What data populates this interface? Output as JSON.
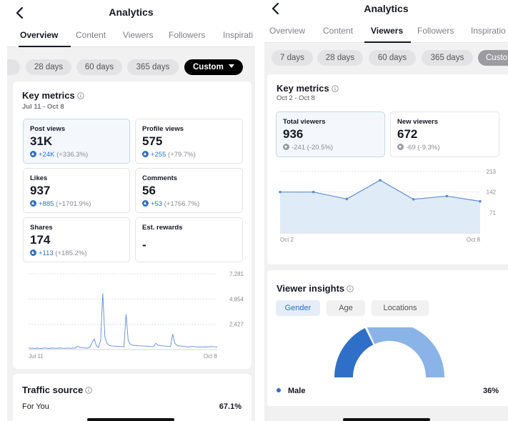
{
  "left": {
    "title": "Analytics",
    "tabs": [
      {
        "label": "Overview",
        "active": true
      },
      {
        "label": "Content",
        "active": false
      },
      {
        "label": "Viewers",
        "active": false
      },
      {
        "label": "Followers",
        "active": false
      },
      {
        "label": "Inspirati",
        "active": false
      }
    ],
    "pills": [
      {
        "label": "",
        "selected": false
      },
      {
        "label": "28 days",
        "selected": false
      },
      {
        "label": "60 days",
        "selected": false
      },
      {
        "label": "365 days",
        "selected": false
      },
      {
        "label": "Custom",
        "selected": true
      }
    ],
    "key_metrics": {
      "title": "Key metrics",
      "date_range": "Jul 11 - Oct 8",
      "metrics": [
        {
          "label": "Post views",
          "value": "31K",
          "delta": "+24K",
          "pct": "(+336.3%)",
          "selected": true
        },
        {
          "label": "Profile views",
          "value": "575",
          "delta": "+255",
          "pct": "(+79.7%)",
          "selected": false
        },
        {
          "label": "Likes",
          "value": "937",
          "delta": "+885",
          "pct": "(+1701.9%)",
          "selected": false
        },
        {
          "label": "Comments",
          "value": "56",
          "delta": "+53",
          "pct": "(+1766.7%)",
          "selected": false
        },
        {
          "label": "Shares",
          "value": "174",
          "delta": "+113",
          "pct": "(+185.2%)",
          "selected": false
        },
        {
          "label": "Est. rewards",
          "value": "-",
          "delta": "",
          "pct": "",
          "selected": false
        }
      ]
    },
    "traffic": {
      "title": "Traffic source",
      "row_label": "For You",
      "row_value": "67.1%"
    }
  },
  "right": {
    "title": "Analytics",
    "tabs": [
      {
        "label": "Overview",
        "active": false
      },
      {
        "label": "Content",
        "active": false
      },
      {
        "label": "Viewers",
        "active": true
      },
      {
        "label": "Followers",
        "active": false
      },
      {
        "label": "Inspiratio",
        "active": false
      }
    ],
    "pills": [
      {
        "label": "7 days",
        "selected": false
      },
      {
        "label": "28 days",
        "selected": false
      },
      {
        "label": "60 days",
        "selected": false
      },
      {
        "label": "365 days",
        "selected": false
      },
      {
        "label": "Custo",
        "selected": true
      }
    ],
    "key_metrics": {
      "title": "Key metrics",
      "date_range": "Oct 2 - Oct 8",
      "metrics": [
        {
          "label": "Total viewers",
          "value": "936",
          "delta": "-241",
          "pct": "(-20.5%)",
          "selected": true
        },
        {
          "label": "New viewers",
          "value": "672",
          "delta": "-69",
          "pct": "(-9.3%)",
          "selected": false
        }
      ]
    },
    "insights": {
      "title": "Viewer insights",
      "segments": [
        {
          "label": "Gender",
          "active": true
        },
        {
          "label": "Age",
          "active": false
        },
        {
          "label": "Locations",
          "active": false
        }
      ],
      "legend_label": "Male",
      "legend_value": "36%",
      "male_fraction": 0.36
    }
  },
  "colors": {
    "accent": "#2f6fc7",
    "fill": "#dbe8f7",
    "line": "#5b8ed1",
    "donut_light": "#8ab4e8"
  },
  "chart_data": [
    {
      "type": "line",
      "x_labels": [
        "Jul 11",
        "Oct 8"
      ],
      "ylim": [
        0,
        7281
      ],
      "y_ticks": [
        2427,
        4854,
        7281
      ],
      "y_tick_labels": [
        "2,427",
        "4,854",
        "7,281"
      ],
      "grid": true,
      "series": [
        {
          "values": [
            150,
            120,
            130,
            110,
            140,
            120,
            100,
            130,
            150,
            120,
            110,
            140,
            130,
            120,
            140,
            150,
            130,
            120,
            140,
            130,
            120,
            150,
            140,
            300,
            250,
            180,
            160,
            150,
            140,
            250,
            700,
            1000,
            350,
            200,
            900,
            5400,
            1200,
            600,
            400,
            350,
            330,
            320,
            310,
            300,
            280,
            260,
            3400,
            900,
            500,
            420,
            400,
            380,
            360,
            350,
            340,
            330,
            320,
            300,
            290,
            280,
            600,
            420,
            380,
            360,
            340,
            320,
            300,
            280,
            1500,
            600,
            400,
            350,
            330,
            300,
            280,
            260,
            250,
            300,
            280,
            260,
            250,
            240,
            230,
            250,
            240,
            260,
            280,
            270,
            260,
            250
          ]
        }
      ]
    },
    {
      "type": "area",
      "x_labels": [
        "Oct 2",
        "Oct 8"
      ],
      "ylim": [
        0,
        213
      ],
      "y_ticks": [
        71,
        142,
        213
      ],
      "y_tick_labels": [
        "71",
        "142",
        "213"
      ],
      "grid": true,
      "series": [
        {
          "values": [
            142,
            142,
            118,
            183,
            117,
            128,
            110
          ]
        }
      ]
    }
  ]
}
